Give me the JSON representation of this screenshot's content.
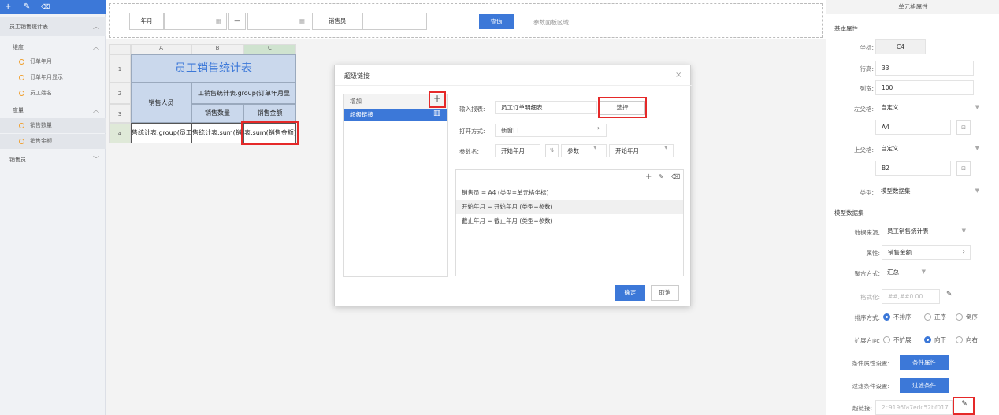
{
  "toolbar": {
    "add": "+",
    "edit": "✎",
    "delete": "🗑"
  },
  "left_panel": {
    "dataset_title": "员工销售统计表",
    "dimension_label": "维度",
    "dimensions": [
      "订单年月",
      "订单年月显示",
      "员工姓名"
    ],
    "measure_label": "度量",
    "measures": [
      "销售数量",
      "销售金额"
    ],
    "other_label": "销售员"
  },
  "param_bar": {
    "year_month_label": "年月",
    "dash": "—",
    "salesperson_label": "销售员",
    "query_button": "查询",
    "panel_area": "参数面板区域"
  },
  "grid": {
    "col_headers": [
      "A",
      "B",
      "C"
    ],
    "row_headers": [
      "1",
      "2",
      "3",
      "4"
    ],
    "title": "员工销售统计表",
    "r2_a": "销售人员",
    "r2_bc": "工销售统计表.group(订单年月显",
    "r3_b": "销售数量",
    "r3_c": "销售金额",
    "r4_a": "售统计表.group(员工",
    "r4_b": "售统计表.sum(销售",
    "r4_c": "表.sum(销售金额)"
  },
  "dialog": {
    "title": "超级链接",
    "close": "×",
    "add_header": "增加",
    "item": "超级链接",
    "report_label": "输入报表:",
    "report_value": "员工订单明细表",
    "select_button": "选择",
    "open_label": "打开方式:",
    "open_value": "新窗口",
    "param_label": "参数名:",
    "param_name": "开始年月",
    "param_type": "参数",
    "param_value": "开始年月",
    "params": [
      "销售员 = A4 (类型=单元格坐标)",
      "开始年月 = 开始年月 (类型=参数)",
      "截止年月 = 截止年月 (类型=参数)"
    ],
    "ok": "确定",
    "cancel": "取消"
  },
  "right_panel": {
    "title": "单元格属性",
    "basic": "基本属性",
    "coord_label": "坐标:",
    "coord_value": "C4",
    "row_h_label": "行高:",
    "row_h_value": "33",
    "col_w_label": "列宽:",
    "col_w_value": "100",
    "left_parent_label": "左父格:",
    "left_parent_value": "自定义",
    "left_parent_cell": "A4",
    "top_parent_label": "上父格:",
    "top_parent_value": "自定义",
    "top_parent_cell": "B2",
    "type_label": "类型:",
    "type_value": "模型数据集",
    "model_section": "模型数据集",
    "source_label": "数据来源:",
    "source_value": "员工销售统计表",
    "attr_label": "属性:",
    "attr_value": "销售金额",
    "agg_label": "聚合方式:",
    "agg_value": "汇总",
    "format_label": "格式化:",
    "format_placeholder": "##,##0.00",
    "sort_label": "排序方式:",
    "sort_options": [
      "不排序",
      "正序",
      "倒序"
    ],
    "expand_label": "扩展方向:",
    "expand_options": [
      "不扩展",
      "向下",
      "向右"
    ],
    "cond_label": "条件属性设置:",
    "cond_button": "条件属性",
    "filter_label": "过滤条件设置:",
    "filter_button": "过滤条件",
    "link_label": "超链接:",
    "link_value": "2c9196fa7edc52bf017"
  },
  "colors": {
    "accent": "#3c78d8",
    "highlight": "#e52929"
  }
}
